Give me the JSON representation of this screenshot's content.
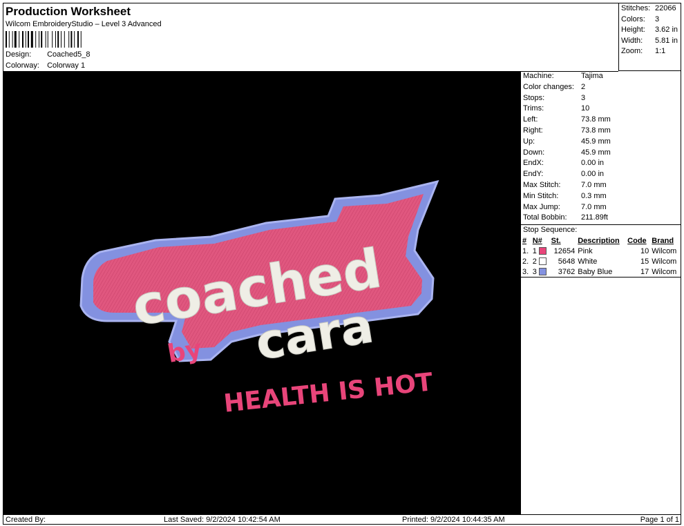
{
  "header": {
    "title": "Production Worksheet",
    "subtitle": "Wilcom EmbroideryStudio – Level 3 Advanced",
    "design_label": "Design:",
    "design_value": "Coached5_8",
    "colorway_label": "Colorway:",
    "colorway_value": "Colorway 1"
  },
  "stats": [
    {
      "label": "Stitches:",
      "value": "22066"
    },
    {
      "label": "Colors:",
      "value": "3"
    },
    {
      "label": "Height:",
      "value": "3.62 in"
    },
    {
      "label": "Width:",
      "value": "5.81 in"
    },
    {
      "label": "Zoom:",
      "value": "1:1"
    }
  ],
  "specs": [
    {
      "label": "Machine:",
      "value": "Tajima"
    },
    {
      "label": "Color changes:",
      "value": "2"
    },
    {
      "label": "Stops:",
      "value": "3"
    },
    {
      "label": "Trims:",
      "value": "10"
    },
    {
      "label": "Left:",
      "value": "73.8 mm"
    },
    {
      "label": "Right:",
      "value": "73.8 mm"
    },
    {
      "label": "Up:",
      "value": "45.9 mm"
    },
    {
      "label": "Down:",
      "value": "45.9 mm"
    },
    {
      "label": "EndX:",
      "value": "0.00 in"
    },
    {
      "label": "EndY:",
      "value": "0.00 in"
    },
    {
      "label": "Max Stitch:",
      "value": "7.0 mm"
    },
    {
      "label": "Min Stitch:",
      "value": "0.3 mm"
    },
    {
      "label": "Max Jump:",
      "value": "7.0 mm"
    },
    {
      "label": "Total Bobbin:",
      "value": "211.89ft"
    }
  ],
  "stop_sequence": {
    "title": "Stop Sequence:",
    "headers": [
      "#",
      "N#",
      "St.",
      "Description",
      "Code",
      "Brand"
    ],
    "rows": [
      {
        "num": "1.",
        "n": "1",
        "color": "#e8457a",
        "st": "12654",
        "desc": "Pink",
        "code": "10",
        "brand": "Wilcom"
      },
      {
        "num": "2.",
        "n": "2",
        "color": "#ffffff",
        "st": "5648",
        "desc": "White",
        "code": "15",
        "brand": "Wilcom"
      },
      {
        "num": "3.",
        "n": "3",
        "color": "#8391e0",
        "st": "3762",
        "desc": "Baby Blue",
        "code": "17",
        "brand": "Wilcom"
      }
    ]
  },
  "design_art": {
    "line1": "coached",
    "line2": "cara",
    "by": "by",
    "tagline": "HEALTH IS HOT"
  },
  "footer": {
    "created_by": "Created By:",
    "last_saved": "Last Saved: 9/2/2024 10:42:54 AM",
    "printed": "Printed: 9/2/2024 10:44:35 AM",
    "page": "Page 1 of 1"
  }
}
